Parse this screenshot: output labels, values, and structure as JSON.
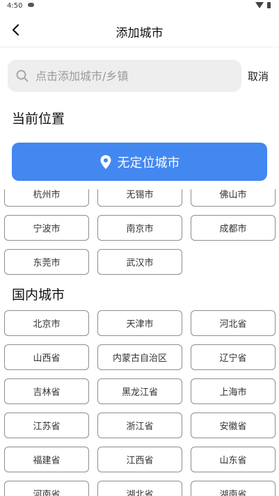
{
  "status": {
    "time": "4:50"
  },
  "header": {
    "title": "添加城市"
  },
  "search": {
    "placeholder": "点击添加城市/乡镇",
    "cancel_label": "取消"
  },
  "current_location": {
    "section_title": "当前位置",
    "button_label": "无定位城市"
  },
  "hot_cities": [
    "杭州市",
    "无锡市",
    "佛山市",
    "宁波市",
    "南京市",
    "成都市",
    "东莞市",
    "武汉市"
  ],
  "domestic": {
    "section_title": "国内城市",
    "cities": [
      "北京市",
      "天津市",
      "河北省",
      "山西省",
      "内蒙古自治区",
      "辽宁省",
      "吉林省",
      "黑龙江省",
      "上海市",
      "江苏省",
      "浙江省",
      "安徽省",
      "福建省",
      "江西省",
      "山东省",
      "河南省",
      "湖北省",
      "湖南省"
    ]
  },
  "colors": {
    "accent": "#4387f0",
    "button_border": "#8d8d8d",
    "search_bg": "#eeeeee"
  }
}
